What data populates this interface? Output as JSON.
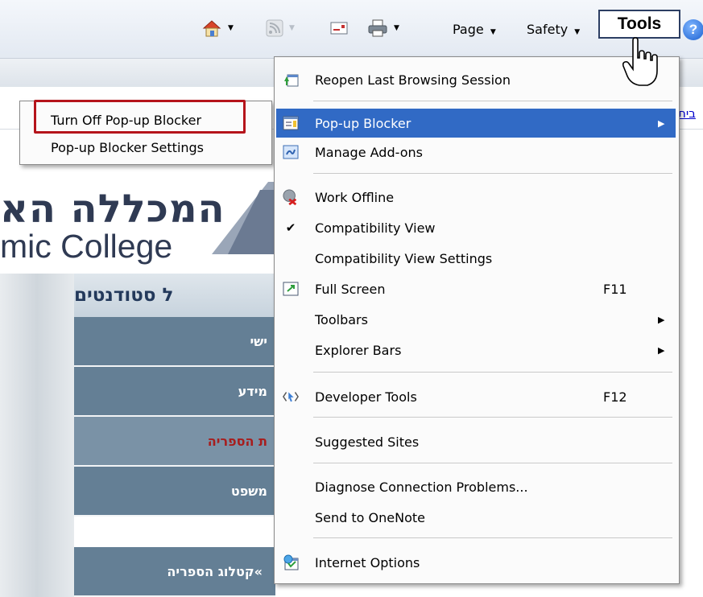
{
  "commandbar": {
    "page_label": "Page",
    "safety_label": "Safety",
    "tools_label": "Tools",
    "help_glyph": "?",
    "icons": [
      "home-icon",
      "feeds-icon",
      "read-mail-icon",
      "print-icon",
      "help-icon"
    ]
  },
  "header": {
    "top_link": "בית"
  },
  "logo": {
    "hebrew": "המכללה הא",
    "english": "mic College"
  },
  "nav": {
    "heading": "ל סטודנטים",
    "items": [
      {
        "label": "ישי"
      },
      {
        "label": "מידע"
      },
      {
        "label": "ת הספריה"
      },
      {
        "label": "משפט"
      },
      {
        "label": "קטלוג הספריה"
      }
    ]
  },
  "tools_menu": {
    "items": [
      {
        "label": "Reopen Last Browsing Session",
        "icon": "reopen-session-icon"
      },
      {
        "label": "Pop-up Blocker",
        "icon": "popup-blocker-icon",
        "submenu": true,
        "highlighted": true
      },
      {
        "label": "Manage Add-ons",
        "icon": "addons-icon"
      },
      {
        "label": "Work Offline",
        "icon": "work-offline-icon"
      },
      {
        "label": "Compatibility View",
        "icon": "check-icon",
        "checked": true
      },
      {
        "label": "Compatibility View Settings"
      },
      {
        "label": "Full Screen",
        "icon": "fullscreen-icon",
        "shortcut": "F11"
      },
      {
        "label": "Toolbars",
        "submenu": true
      },
      {
        "label": "Explorer Bars",
        "submenu": true
      },
      {
        "label": "Developer Tools",
        "icon": "developer-tools-icon",
        "shortcut": "F12"
      },
      {
        "label": "Suggested Sites"
      },
      {
        "label": "Diagnose Connection Problems..."
      },
      {
        "label": "Send to OneNote"
      },
      {
        "label": "Internet Options",
        "icon": "internet-options-icon"
      }
    ]
  },
  "popup_submenu": {
    "items": [
      {
        "label": "Turn Off Pop-up Blocker"
      },
      {
        "label": "Pop-up Blocker Settings"
      }
    ]
  },
  "colors": {
    "highlight": "#316ac5",
    "callout_border": "#b5141b",
    "nav_bg": "#647f95"
  }
}
